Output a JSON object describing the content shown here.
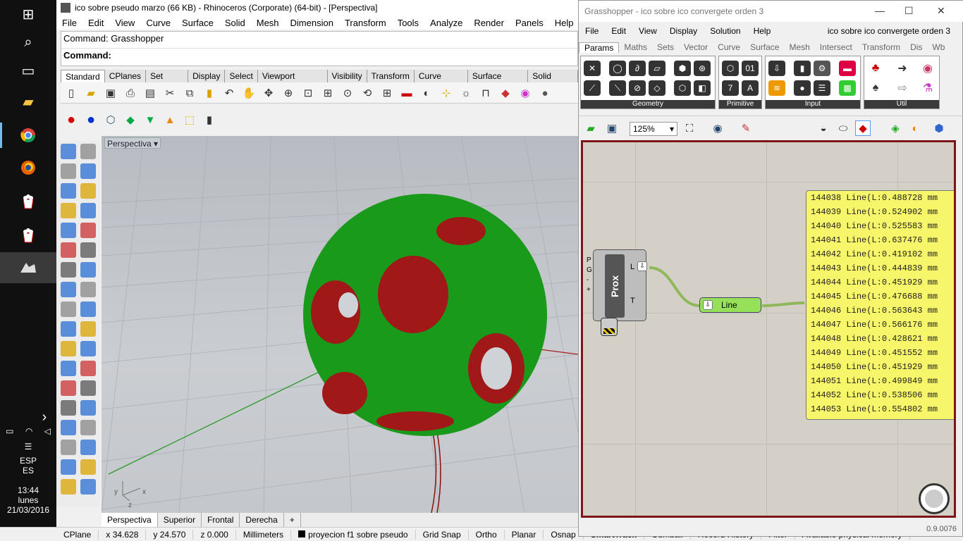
{
  "taskbar": {
    "lang1": "ESP",
    "lang2": "ES",
    "time": "13:44",
    "day": "lunes",
    "date": "21/03/2016"
  },
  "rhino": {
    "title": "ico sobre pseudo marzo (66 KB) - Rhinoceros (Corporate) (64-bit) - [Perspectiva]",
    "menu": [
      "File",
      "Edit",
      "View",
      "Curve",
      "Surface",
      "Solid",
      "Mesh",
      "Dimension",
      "Transform",
      "Tools",
      "Analyze",
      "Render",
      "Panels",
      "Help"
    ],
    "command_history": "Command: Grasshopper",
    "command_prompt": "Command:",
    "toolbar_tabs": [
      "Standard",
      "CPlanes",
      "Set View",
      "Display",
      "Select",
      "Viewport Layout",
      "Visibility",
      "Transform",
      "Curve Tools",
      "Surface Tools",
      "Solid Tools"
    ],
    "viewport_label": "Perspectiva",
    "viewport_tabs": [
      "Perspectiva",
      "Superior",
      "Frontal",
      "Derecha"
    ],
    "add_tab": "+",
    "status": {
      "cplane": "CPlane",
      "x": "x 34.628",
      "y": "y 24.570",
      "z": "z 0.000",
      "units": "Millimeters",
      "layer": "proyecion f1 sobre pseudo",
      "grid_snap": "Grid Snap",
      "ortho": "Ortho",
      "planar": "Planar",
      "osnap": "Osnap",
      "smarttrack": "SmartTrack",
      "gumball": "Gumball",
      "record_history": "Record History",
      "filter": "Filter",
      "memory": "Available physical memory"
    },
    "axis": {
      "x": "x",
      "y": "y",
      "z": "z"
    }
  },
  "grasshopper": {
    "title": "Grasshopper - ico sobre ico convergete orden 3",
    "menu": [
      "File",
      "Edit",
      "View",
      "Display",
      "Solution",
      "Help"
    ],
    "doc_name": "ico sobre ico convergete orden 3",
    "tabs": [
      "Params",
      "Maths",
      "Sets",
      "Vector",
      "Curve",
      "Surface",
      "Mesh",
      "Intersect",
      "Transform",
      "Dis",
      "Wb"
    ],
    "groups": [
      "Geometry",
      "Primitive",
      "Input",
      "Util"
    ],
    "zoom": "125%",
    "prox": {
      "name": "Prox",
      "inputs": [
        "P",
        "G",
        "-",
        "+"
      ],
      "outputs": [
        "L",
        "T"
      ]
    },
    "line_label": "Line",
    "panel_rows": [
      {
        "idx": "144038",
        "val": "Line(L:0.488728 mm"
      },
      {
        "idx": "144039",
        "val": "Line(L:0.524902 mm"
      },
      {
        "idx": "144040",
        "val": "Line(L:0.525583 mm"
      },
      {
        "idx": "144041",
        "val": "Line(L:0.637476 mm"
      },
      {
        "idx": "144042",
        "val": "Line(L:0.419102 mm"
      },
      {
        "idx": "144043",
        "val": "Line(L:0.444839 mm"
      },
      {
        "idx": "144044",
        "val": "Line(L:0.451929 mm"
      },
      {
        "idx": "144045",
        "val": "Line(L:0.476688 mm"
      },
      {
        "idx": "144046",
        "val": "Line(L:0.563643 mm"
      },
      {
        "idx": "144047",
        "val": "Line(L:0.566176 mm"
      },
      {
        "idx": "144048",
        "val": "Line(L:0.428621 mm"
      },
      {
        "idx": "144049",
        "val": "Line(L:0.451552 mm"
      },
      {
        "idx": "144050",
        "val": "Line(L:0.451929 mm"
      },
      {
        "idx": "144051",
        "val": "Line(L:0.499849 mm"
      },
      {
        "idx": "144052",
        "val": "Line(L:0.538506 mm"
      },
      {
        "idx": "144053",
        "val": "Line(L:0.554802 mm"
      }
    ],
    "version": "0.9.0076"
  },
  "colors": {
    "accent": "#76b9ed",
    "gh_canvas_border": "#7d1516",
    "panel_yellow": "#f7f56a",
    "mesh_green": "#1a9a1a",
    "mesh_red": "#a01818"
  }
}
